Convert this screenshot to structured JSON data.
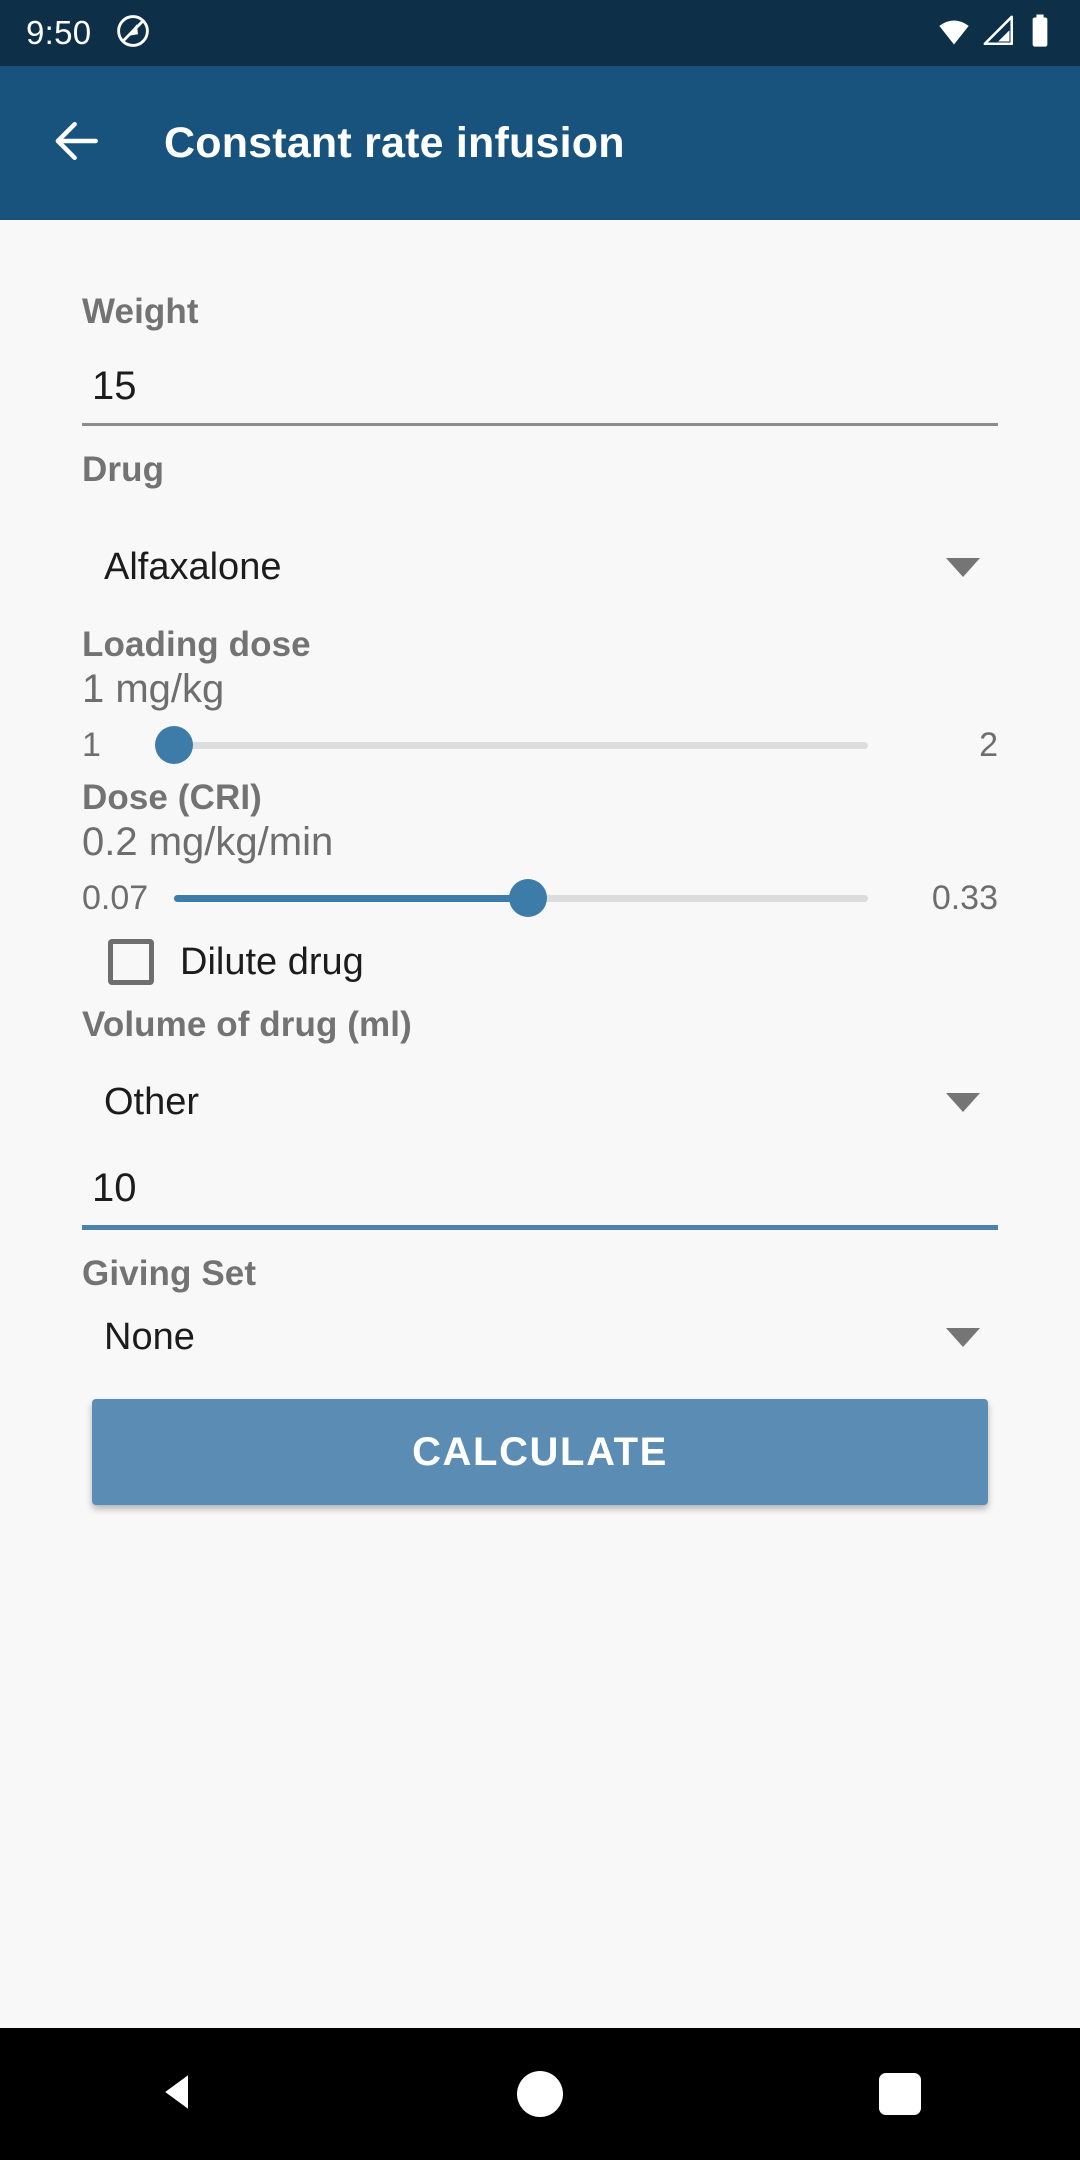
{
  "status_bar": {
    "time": "9:50",
    "notification_icon": "circle-slash-icon",
    "wifi_icon": "wifi-icon",
    "signal_icon": "cellular-signal-icon",
    "battery_icon": "battery-full-icon",
    "background_color": "#0d2f47"
  },
  "app_bar": {
    "back_icon": "arrow-left-icon",
    "title": "Constant rate infusion",
    "background_color": "#18537e"
  },
  "form": {
    "weight": {
      "label": "Weight",
      "value": "15",
      "placeholder": "",
      "underline_color": "#8c8c8c"
    },
    "drug": {
      "label": "Drug",
      "selected": "Alfaxalone",
      "caret_icon": "chevron-down-icon"
    },
    "loading_dose": {
      "label": "Loading dose",
      "value_text": "1 mg/kg",
      "min": "1",
      "max": "2",
      "fill_percent": 0,
      "thumb_percent": 0,
      "accent_color": "#3d7ba8"
    },
    "dose_cri": {
      "label": "Dose (CRI)",
      "value_text": "0.2 mg/kg/min",
      "min": "0.07",
      "max": "0.33",
      "fill_percent": 51,
      "thumb_percent": 51,
      "accent_color": "#3d7ba8"
    },
    "dilute_drug": {
      "label": "Dilute drug",
      "checked": false
    },
    "volume_of_drug": {
      "label": "Volume of drug (ml)",
      "selected": "Other",
      "caret_icon": "chevron-down-icon",
      "value": "10",
      "underline_color": "#4a82ab"
    },
    "giving_set": {
      "label": "Giving Set",
      "selected": "None",
      "caret_icon": "chevron-down-icon"
    },
    "calculate_button": {
      "label": "CALCULATE",
      "background_color": "#5b8cb4"
    }
  },
  "nav_bar": {
    "back_icon": "triangle-back-icon",
    "home_icon": "circle-home-icon",
    "recents_icon": "square-recents-icon",
    "background_color": "#000000"
  }
}
